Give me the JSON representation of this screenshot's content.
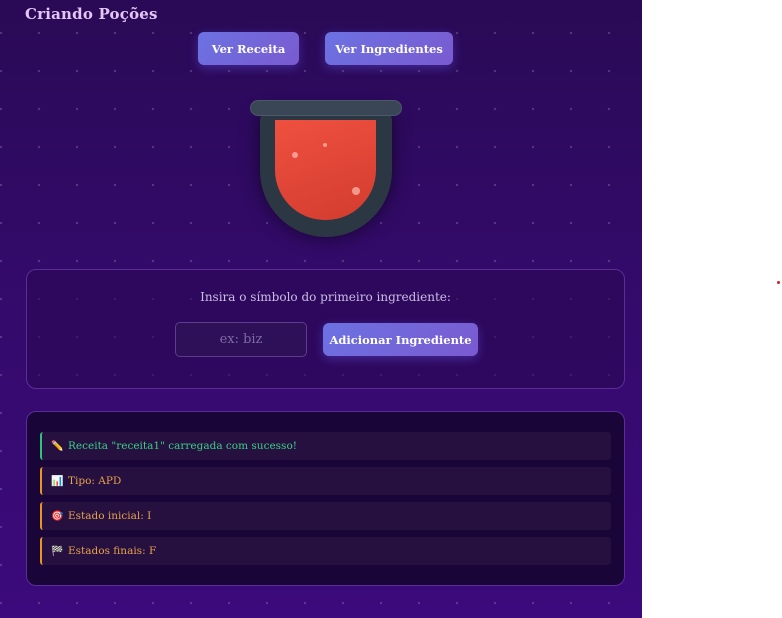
{
  "app": {
    "title": "Criando Poções",
    "buttons": {
      "recipe_label": "Ver Receita",
      "ingredients_label": "Ver Ingredientes"
    }
  },
  "cauldron": {
    "liquid_color": "#e24a3a"
  },
  "ingredient_form": {
    "prompt": "Insira o símbolo do primeiro ingrediente:",
    "input_value": "",
    "input_placeholder": "ex: biz",
    "add_label": "Adicionar Ingrediente"
  },
  "log": {
    "entries": [
      {
        "icon": "pencil-icon",
        "glyph": "✏️",
        "text": "Receita \"receita1\" carregada com sucesso!",
        "status": "success"
      },
      {
        "icon": "chart-icon",
        "glyph": "📊",
        "text": "Tipo: APD",
        "status": "info"
      },
      {
        "icon": "target-icon",
        "glyph": "🎯",
        "text": "Estado inicial: I",
        "status": "info"
      },
      {
        "icon": "checkered-flag-icon",
        "glyph": "🏁",
        "text": "Estados finais: F",
        "status": "info"
      }
    ]
  },
  "colors": {
    "accent": "#6c72e2",
    "success": "#38d184",
    "info": "#e7a24a",
    "background": "#330a6a"
  }
}
